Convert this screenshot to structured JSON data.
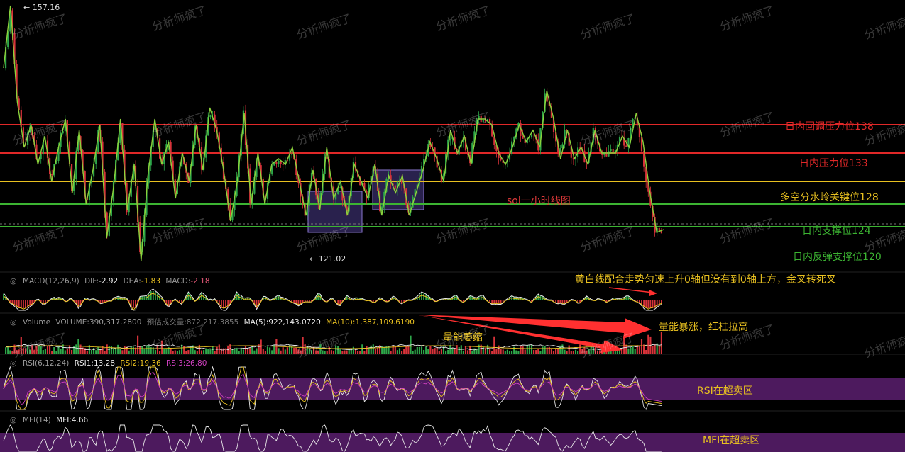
{
  "chart_data": [
    {
      "type": "candlestick",
      "title": "sol一小时线图",
      "high_marker": "157.16",
      "low_marker": "121.02",
      "close_approx": 119.5,
      "ylim": [
        112,
        160
      ],
      "price_path": [
        148,
        159,
        142,
        134,
        138,
        131,
        136,
        128,
        134,
        139,
        126,
        137,
        124,
        130,
        138,
        118,
        127,
        139,
        123,
        131,
        114,
        129,
        139,
        131,
        135,
        125,
        133,
        128,
        138,
        130,
        141,
        137,
        130,
        121,
        128,
        140,
        124,
        133,
        124,
        131,
        132,
        131,
        134,
        128,
        122,
        130,
        123,
        134,
        125,
        128,
        122,
        131,
        128,
        125,
        131,
        122,
        129,
        126,
        129,
        122,
        126,
        130,
        135,
        132,
        128,
        137,
        133,
        136,
        131,
        139,
        139,
        138,
        133,
        131,
        134,
        138,
        135,
        137,
        134,
        144,
        139,
        132,
        137,
        132,
        134,
        131,
        137,
        133,
        133,
        133,
        136,
        134,
        140,
        135,
        126,
        119,
        119.5
      ],
      "levels": [
        {
          "value": 138,
          "label": "日内回调压力位138",
          "color": "#e02828"
        },
        {
          "value": 133,
          "label": "日内压力位133",
          "color": "#e02828"
        },
        {
          "value": 128,
          "label": "多空分水岭关键位128",
          "color": "#e8c020"
        },
        {
          "value": 124,
          "label": "日内支撑位124",
          "color": "#3cb432"
        },
        {
          "value": 120,
          "label": "日内反弹支撑位120",
          "color": "#3cb432"
        }
      ]
    },
    {
      "type": "line",
      "indicator": "MACD(12,26,9)",
      "series": [
        {
          "name": "DIF",
          "value": "-2.92",
          "color": "#e8e8e8"
        },
        {
          "name": "DEA",
          "value": "-1.83",
          "color": "#e8c020"
        },
        {
          "name": "MACD",
          "value": "-2.18",
          "color": "#e85a7a"
        }
      ]
    },
    {
      "type": "bar",
      "indicator": "Volume",
      "series": [
        {
          "name": "VOLUME",
          "value": "390,317.2800",
          "color": "#888888"
        },
        {
          "name": "预估成交量",
          "value": "872,217.3855",
          "color": "#666666"
        },
        {
          "name": "MA(5)",
          "value": "922,143.0720",
          "color": "#e8e8e8"
        },
        {
          "name": "MA(10)",
          "value": "1,387,109.6190",
          "color": "#e8c020"
        }
      ]
    },
    {
      "type": "line",
      "indicator": "RSI(6,12,24)",
      "series": [
        {
          "name": "RSI1",
          "value": "13.28",
          "color": "#e8e8e8"
        },
        {
          "name": "RSI2",
          "value": "19.36",
          "color": "#e8c020"
        },
        {
          "name": "RSI3",
          "value": "26.80",
          "color": "#d040c0"
        }
      ]
    },
    {
      "type": "line",
      "indicator": "MFI(14)",
      "series": [
        {
          "name": "MFI",
          "value": "4.66",
          "color": "#e8e8e8"
        }
      ]
    }
  ],
  "annotations": {
    "chart_title": "sol一小时线图",
    "macd_note": "黄白线配合走势匀速上升0轴但没有到0轴上方，金叉转死叉",
    "volume_shrink": "量能萎缩",
    "volume_spike": "量能暴涨，红柱拉高",
    "rsi_zone": "RSI在超卖区",
    "mfi_zone": "MFI在超卖区"
  },
  "watermark": "分析师疯了",
  "colors": {
    "up": "#2ea84a",
    "down": "#d8333a",
    "zigzag": "#8cd23c",
    "box_fill": "#4b3c8c",
    "oversold_band": "#5a1e6e",
    "arrow": "#ff3030"
  }
}
